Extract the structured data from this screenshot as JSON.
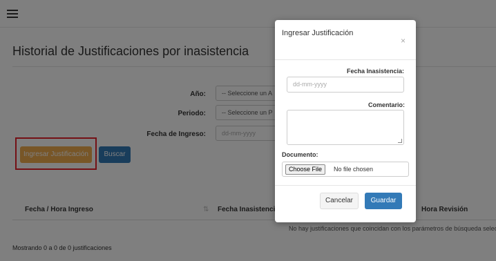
{
  "page": {
    "title": "Historial de Justificaciones por inasistencia"
  },
  "filters": {
    "anio_label": "Año:",
    "anio_value": "-- Seleccione un A",
    "periodo_label": "Periodo:",
    "periodo_value": "-- Seleccione un P",
    "fecha_ingreso_label": "Fecha de Ingreso:",
    "fecha_ingreso_placeholder": "dd-mm-yyyy"
  },
  "actions": {
    "ingresar_label": "Ingresar Justificación",
    "buscar_label": "Buscar"
  },
  "table": {
    "columns": [
      "Fecha / Hora Ingreso",
      "Fecha Inasistencia",
      "Hora Revisión"
    ],
    "empty_message": "No hay justificaciones que coincidan con los parámetros de búsqueda selec",
    "footer": "Mostrando 0 a 0 de 0 justificaciones"
  },
  "modal": {
    "title": "Ingresar Justificación",
    "close_symbol": "×",
    "fecha_label": "Fecha Inasistencia:",
    "fecha_placeholder": "dd-mm-yyyy",
    "comentario_label": "Comentario:",
    "documento_label": "Documento:",
    "choose_file": "Choose File",
    "no_file": "No file chosen",
    "cancel_label": "Cancelar",
    "save_label": "Guardar"
  },
  "colors": {
    "orange": "#f0ad4e",
    "blue": "#337ab7",
    "highlight": "#e8202a"
  }
}
